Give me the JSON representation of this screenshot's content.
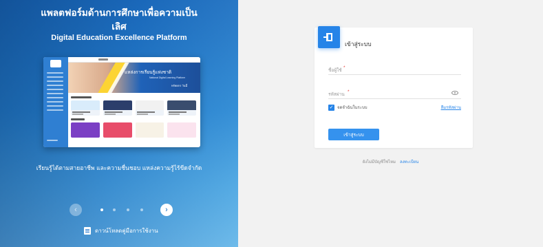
{
  "promo": {
    "title_th_line1": "แพลตฟอร์มด้านการศึกษาเพื่อความเป็น",
    "title_th_line2": "เลิศ",
    "title_en": "Digital Education Excellence Platform",
    "mockup_banner_title": "แหล่งการเรียนรู้แห่งชาติ",
    "mockup_banner_subtitle": "National Digital Learning Platform",
    "mockup_banner_tag": "ทรัพยกร วันนี้",
    "caption": "เรียนรู้ได้ตามสายอาชีพ และความชื่นชอบ แหล่งความรู้ไร้ขีดจำกัด",
    "carousel_prev": "‹",
    "carousel_next": "›",
    "carousel_total": 4,
    "carousel_active": 0,
    "manual_link": "ดาวน์โหลดคู่มือการใช้งาน"
  },
  "login": {
    "title": "เข้าสู่ระบบ",
    "username_placeholder": "ชื่อผู้ใช้",
    "password_placeholder": "รหัสผ่าน",
    "required_mark": "*",
    "remember_label": "จดจำฉันในระบบ",
    "remember_checked": true,
    "checkmark": "✓",
    "forgot_link": "ลืมรหัสผ่าน",
    "submit_label": "เข้าสู่ระบบ"
  },
  "signup": {
    "prompt": "ยังไม่มีบัญชีใช่ไหม",
    "link": "ลงทะเบียน"
  },
  "colors": {
    "accent": "#2684e8",
    "panel_bg": "#f2f2f2",
    "promo_blue": "#2b8ad6"
  },
  "icons": {
    "login_badge": "login-door-icon",
    "password_toggle": "eye-icon",
    "manual": "document-icon"
  }
}
